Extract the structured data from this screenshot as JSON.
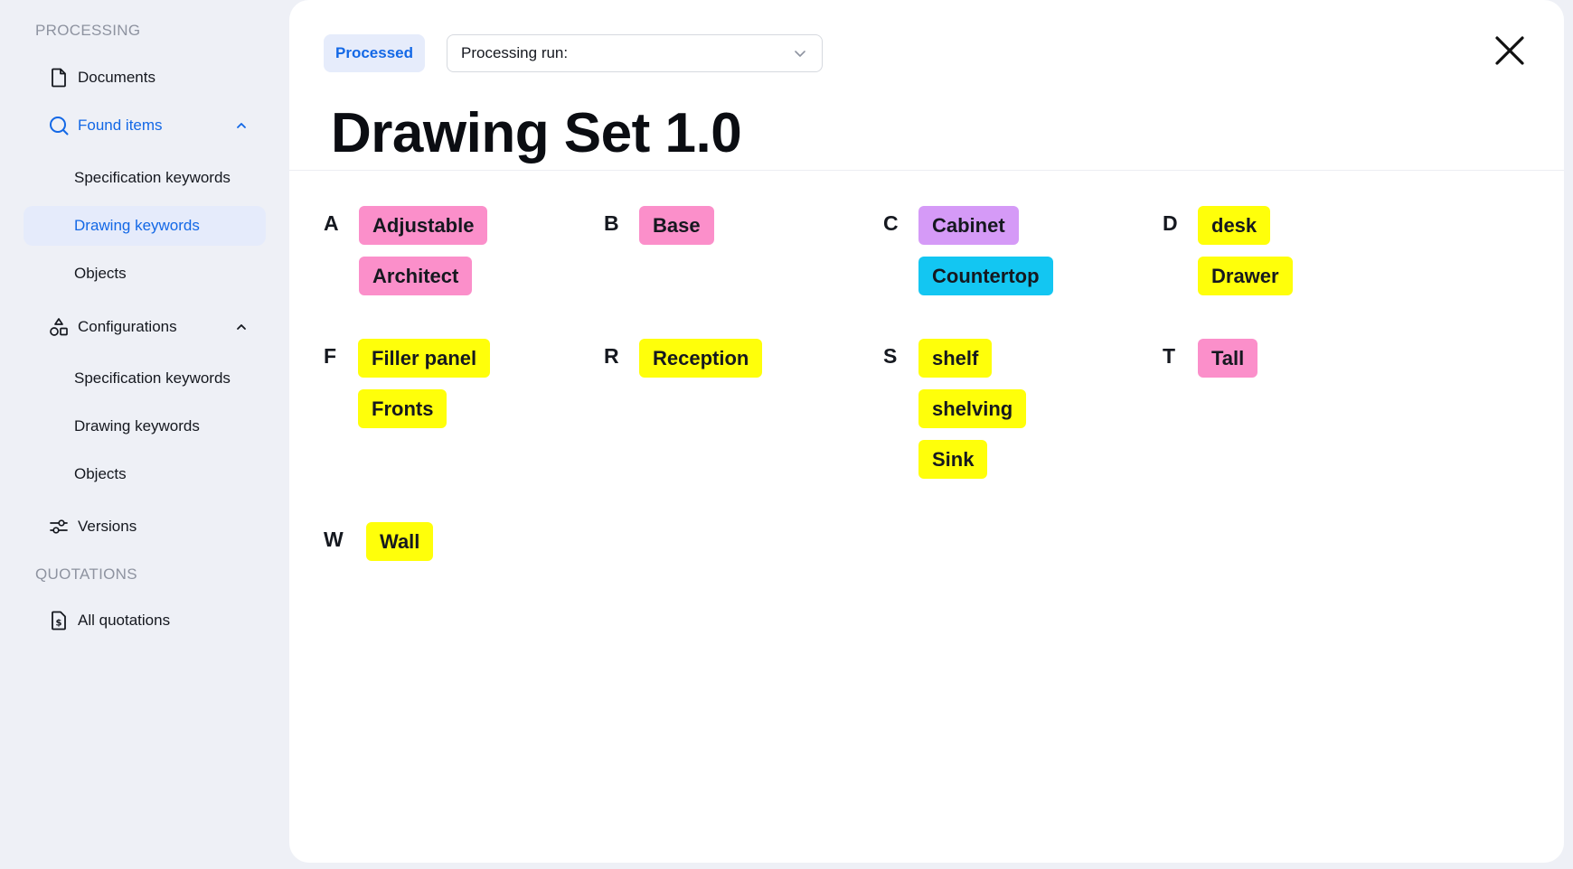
{
  "sidebar": {
    "processing_title": "PROCESSING",
    "documents": "Documents",
    "found_items": "Found items",
    "found_sub": [
      "Specification keywords",
      "Drawing keywords",
      "Objects"
    ],
    "configurations": "Configurations",
    "config_sub": [
      "Specification keywords",
      "Drawing keywords",
      "Objects"
    ],
    "versions": "Versions",
    "quotations_title": "QUOTATIONS",
    "all_quotations": "All quotations"
  },
  "header": {
    "status_badge": "Processed",
    "run_label": "Processing run:",
    "title": "Drawing Set 1.0"
  },
  "colors": {
    "pink": "#fb8fca",
    "purple": "#d59af7",
    "cyan": "#13c6f2",
    "yellow": "#ffff0a",
    "accent": "#1368e6"
  },
  "groups": [
    {
      "letter": "A",
      "tags": [
        {
          "label": "Adjustable",
          "color": "pink"
        },
        {
          "label": "Architect",
          "color": "pink"
        }
      ]
    },
    {
      "letter": "B",
      "tags": [
        {
          "label": "Base",
          "color": "pink"
        }
      ]
    },
    {
      "letter": "C",
      "tags": [
        {
          "label": "Cabinet",
          "color": "purple"
        },
        {
          "label": "Countertop",
          "color": "cyan"
        }
      ]
    },
    {
      "letter": "D",
      "tags": [
        {
          "label": "desk",
          "color": "yellow"
        },
        {
          "label": "Drawer",
          "color": "yellow"
        }
      ]
    },
    {
      "letter": "F",
      "tags": [
        {
          "label": "Filler panel",
          "color": "yellow"
        },
        {
          "label": "Fronts",
          "color": "yellow"
        }
      ]
    },
    {
      "letter": "R",
      "tags": [
        {
          "label": "Reception",
          "color": "yellow"
        }
      ]
    },
    {
      "letter": "S",
      "tags": [
        {
          "label": "shelf",
          "color": "yellow"
        },
        {
          "label": "shelving",
          "color": "yellow"
        },
        {
          "label": "Sink",
          "color": "yellow"
        }
      ]
    },
    {
      "letter": "T",
      "tags": [
        {
          "label": "Tall",
          "color": "pink"
        }
      ]
    },
    {
      "letter": "W",
      "tags": [
        {
          "label": "Wall",
          "color": "yellow"
        }
      ]
    }
  ]
}
